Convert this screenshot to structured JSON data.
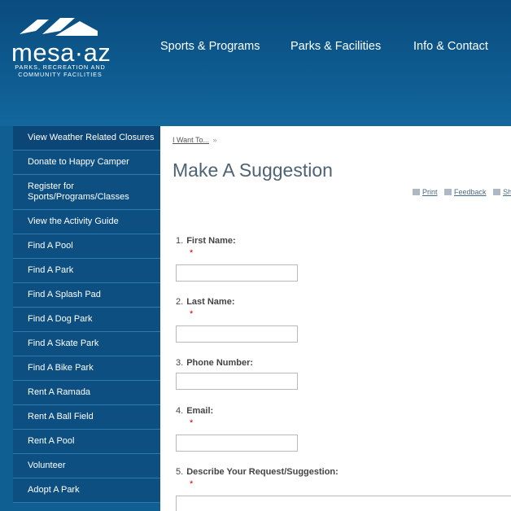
{
  "brand": {
    "name": "mesa·az",
    "subtitle_line1": "PARKS, RECREATION AND",
    "subtitle_line2": "COMMUNITY FACILITIES"
  },
  "nav": {
    "items": [
      "Sports & Programs",
      "Parks & Facilities",
      "Info & Contact"
    ]
  },
  "sidebar": {
    "items": [
      "View Weather Related Closures",
      "Donate to Happy Camper",
      "Register for Sports/Programs/Classes",
      "View the Activity Guide",
      "Find A Pool",
      "Find A Park",
      "Find A Splash Pad",
      "Find A Dog Park",
      "Find A Skate Park",
      "Find A Bike Park",
      "Rent A Ramada",
      "Rent A Ball Field",
      "Rent A Pool",
      "Volunteer",
      "Adopt A Park"
    ]
  },
  "breadcrumb": {
    "link": "I Want To...",
    "separator": "»"
  },
  "page": {
    "title": "Make A Suggestion"
  },
  "tools": {
    "print": "Print",
    "feedback": "Feedback",
    "share": "Sha"
  },
  "form": {
    "required_mark": "*",
    "fields": [
      {
        "num": "1.",
        "label": "First Name:",
        "required": true,
        "value": ""
      },
      {
        "num": "2.",
        "label": "Last Name:",
        "required": true,
        "value": ""
      },
      {
        "num": "3.",
        "label": "Phone Number:",
        "required": false,
        "value": ""
      },
      {
        "num": "4.",
        "label": "Email:",
        "required": true,
        "value": ""
      },
      {
        "num": "5.",
        "label": "Describe Your Request/Suggestion:",
        "required": true,
        "value": ""
      }
    ]
  }
}
